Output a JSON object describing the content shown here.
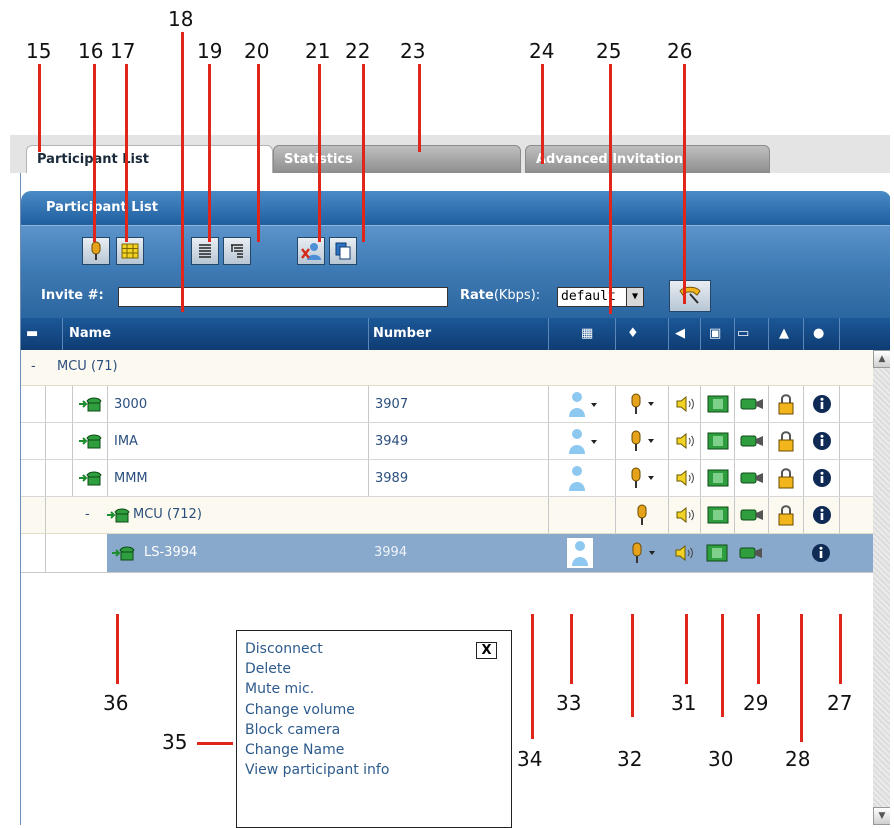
{
  "callouts": [
    "15",
    "16",
    "17",
    "18",
    "19",
    "20",
    "21",
    "22",
    "23",
    "24",
    "25",
    "26",
    "27",
    "28",
    "29",
    "30",
    "31",
    "32",
    "33",
    "34",
    "35",
    "36"
  ],
  "tabs": [
    "Participant List",
    "Statistics",
    "Advanced Invitation"
  ],
  "panel_title": "Participant List",
  "invite_label": "Invite #:",
  "rate_label": "Rate",
  "rate_unit": "(Kbps):",
  "rate_value": "default",
  "columns": {
    "name": "Name",
    "number": "Number"
  },
  "rows": [
    {
      "expander": "-",
      "name": "MCU (71)",
      "number": ""
    },
    {
      "name": "3000",
      "number": "3907"
    },
    {
      "name": "IMA",
      "number": "3949"
    },
    {
      "name": "MMM",
      "number": "3989"
    },
    {
      "expander": "-",
      "name": "MCU (712)",
      "number": ""
    },
    {
      "name": "LS-3994",
      "number": "3994"
    }
  ],
  "context_menu": {
    "items": [
      "Disconnect",
      "Delete",
      "Mute mic.",
      "Change volume",
      "Block camera",
      "Change Name",
      "View participant info"
    ],
    "close": "X"
  },
  "colors": {
    "panel_blue": "#2b66a0",
    "header_navy": "#0f3c73",
    "callout_red": "#e0261a",
    "selected_row": "#89a9cc"
  }
}
